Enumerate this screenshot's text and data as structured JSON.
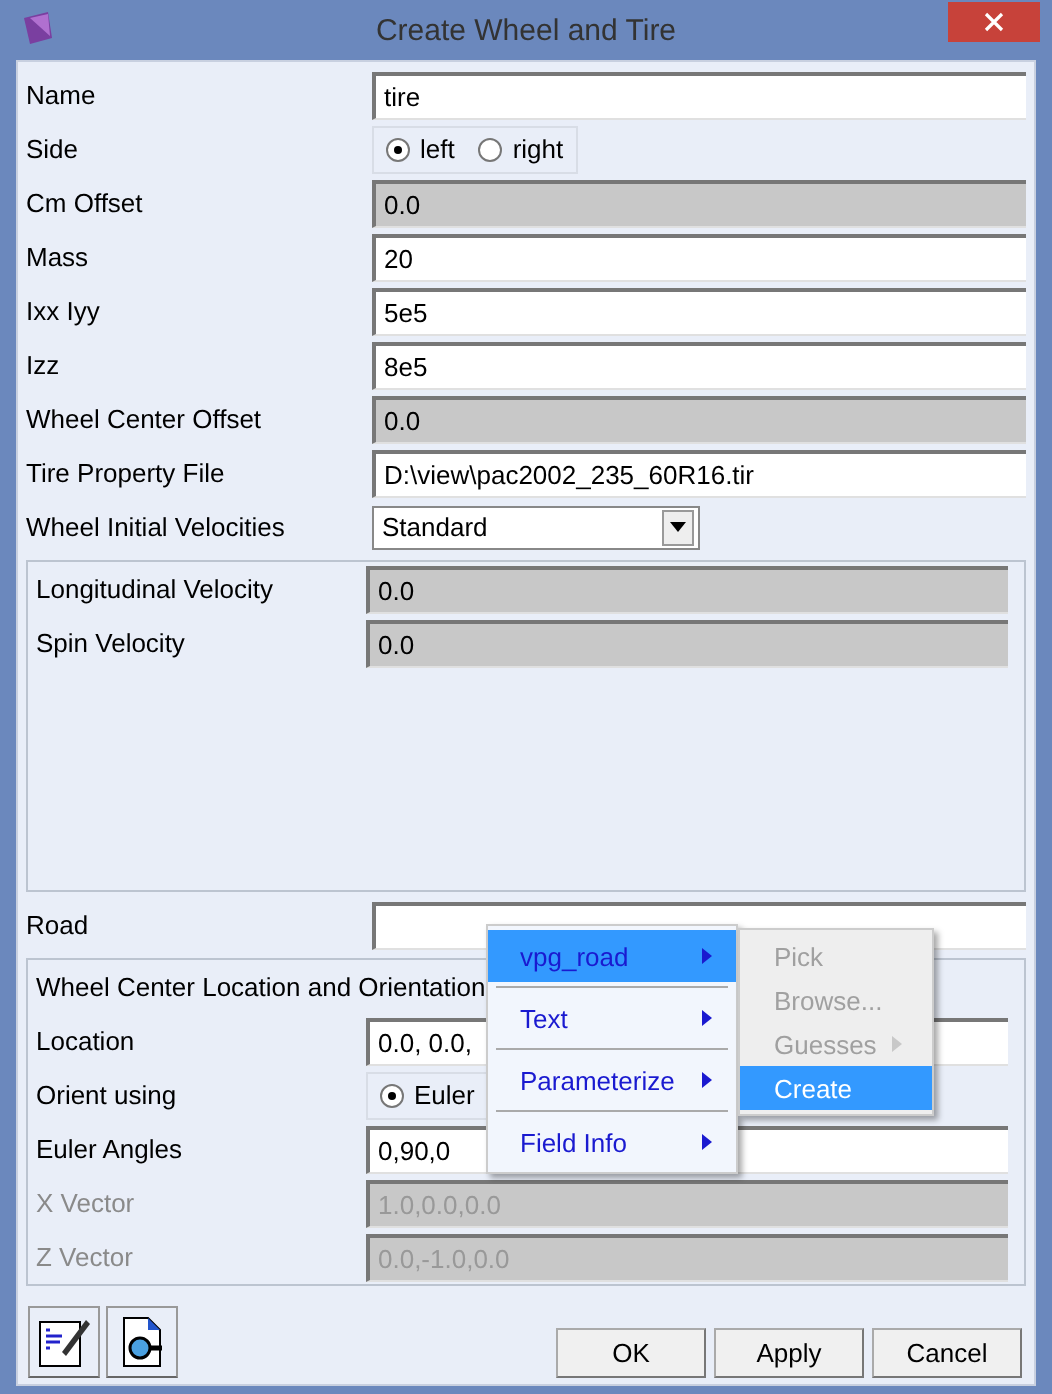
{
  "window": {
    "title": "Create Wheel and Tire"
  },
  "sections": [
    {
      "kind": "plain",
      "rows": [
        {
          "label": "Name",
          "kind": "text",
          "value": "tire",
          "disabled": false,
          "editable": true
        },
        {
          "label": "Side",
          "kind": "radio",
          "options": [
            {
              "label": "left",
              "selected": true
            },
            {
              "label": "right",
              "selected": false
            }
          ]
        },
        {
          "label": "Cm Offset",
          "kind": "text",
          "value": "0.0",
          "disabled": false,
          "editable": false
        },
        {
          "label": "Mass",
          "kind": "text",
          "value": "20",
          "disabled": false,
          "editable": true
        },
        {
          "label": "Ixx Iyy",
          "kind": "text",
          "value": "5e5",
          "disabled": false,
          "editable": true
        },
        {
          "label": "Izz",
          "kind": "text",
          "value": "8e5",
          "disabled": false,
          "editable": true
        },
        {
          "label": "Wheel Center Offset",
          "kind": "text",
          "value": "0.0",
          "disabled": false,
          "editable": false
        },
        {
          "label": "Tire Property File",
          "kind": "text",
          "value": "D:\\view\\pac2002_235_60R16.tir",
          "disabled": false,
          "editable": true
        },
        {
          "label": "Wheel Initial Velocities",
          "kind": "dropdown",
          "value": "Standard"
        }
      ]
    },
    {
      "kind": "group",
      "rows": [
        {
          "label": "Longitudinal Velocity",
          "kind": "text",
          "value": "0.0",
          "disabled": false,
          "editable": false
        },
        {
          "label": "Spin Velocity",
          "kind": "text",
          "value": "0.0",
          "disabled": false,
          "editable": false
        }
      ]
    },
    {
      "kind": "plain",
      "rows": [
        {
          "label": "Road",
          "kind": "text",
          "disabled": false,
          "editable": true
        }
      ]
    },
    {
      "kind": "group",
      "heading": "Wheel Center Location and Orientation",
      "rows": [
        {
          "label": "Location",
          "kind": "text",
          "value": "0.0, 0.0,",
          "disabled": false,
          "editable": true
        },
        {
          "label": "Orient using",
          "kind": "radio",
          "options": [
            {
              "label": "Euler",
              "selected": true
            }
          ]
        },
        {
          "label": "Euler Angles",
          "kind": "text",
          "value": "0,90,0",
          "disabled": false,
          "editable": true
        },
        {
          "label": "X Vector",
          "kind": "text",
          "value": "1.0,0.0,0.0",
          "disabled": true,
          "editable": false
        },
        {
          "label": "Z Vector",
          "kind": "text",
          "value": "0.0,-1.0,0.0",
          "disabled": true,
          "editable": false
        }
      ]
    }
  ],
  "buttons": [
    "OK",
    "Apply",
    "Cancel"
  ],
  "context_menu": {
    "items": [
      {
        "label": "vpg_road",
        "selected": true
      },
      {
        "label": "Text",
        "selected": false
      },
      {
        "label": "Parameterize",
        "selected": false
      },
      {
        "label": "Field Info",
        "selected": false
      }
    ],
    "submenu": [
      {
        "label": "Pick",
        "disabled": true,
        "selected": false,
        "has_submenu": false
      },
      {
        "label": "Browse...",
        "disabled": true,
        "selected": false,
        "has_submenu": false
      },
      {
        "label": "Guesses",
        "disabled": true,
        "selected": false,
        "has_submenu": true
      },
      {
        "label": "Create",
        "disabled": false,
        "selected": true,
        "has_submenu": false
      }
    ]
  }
}
